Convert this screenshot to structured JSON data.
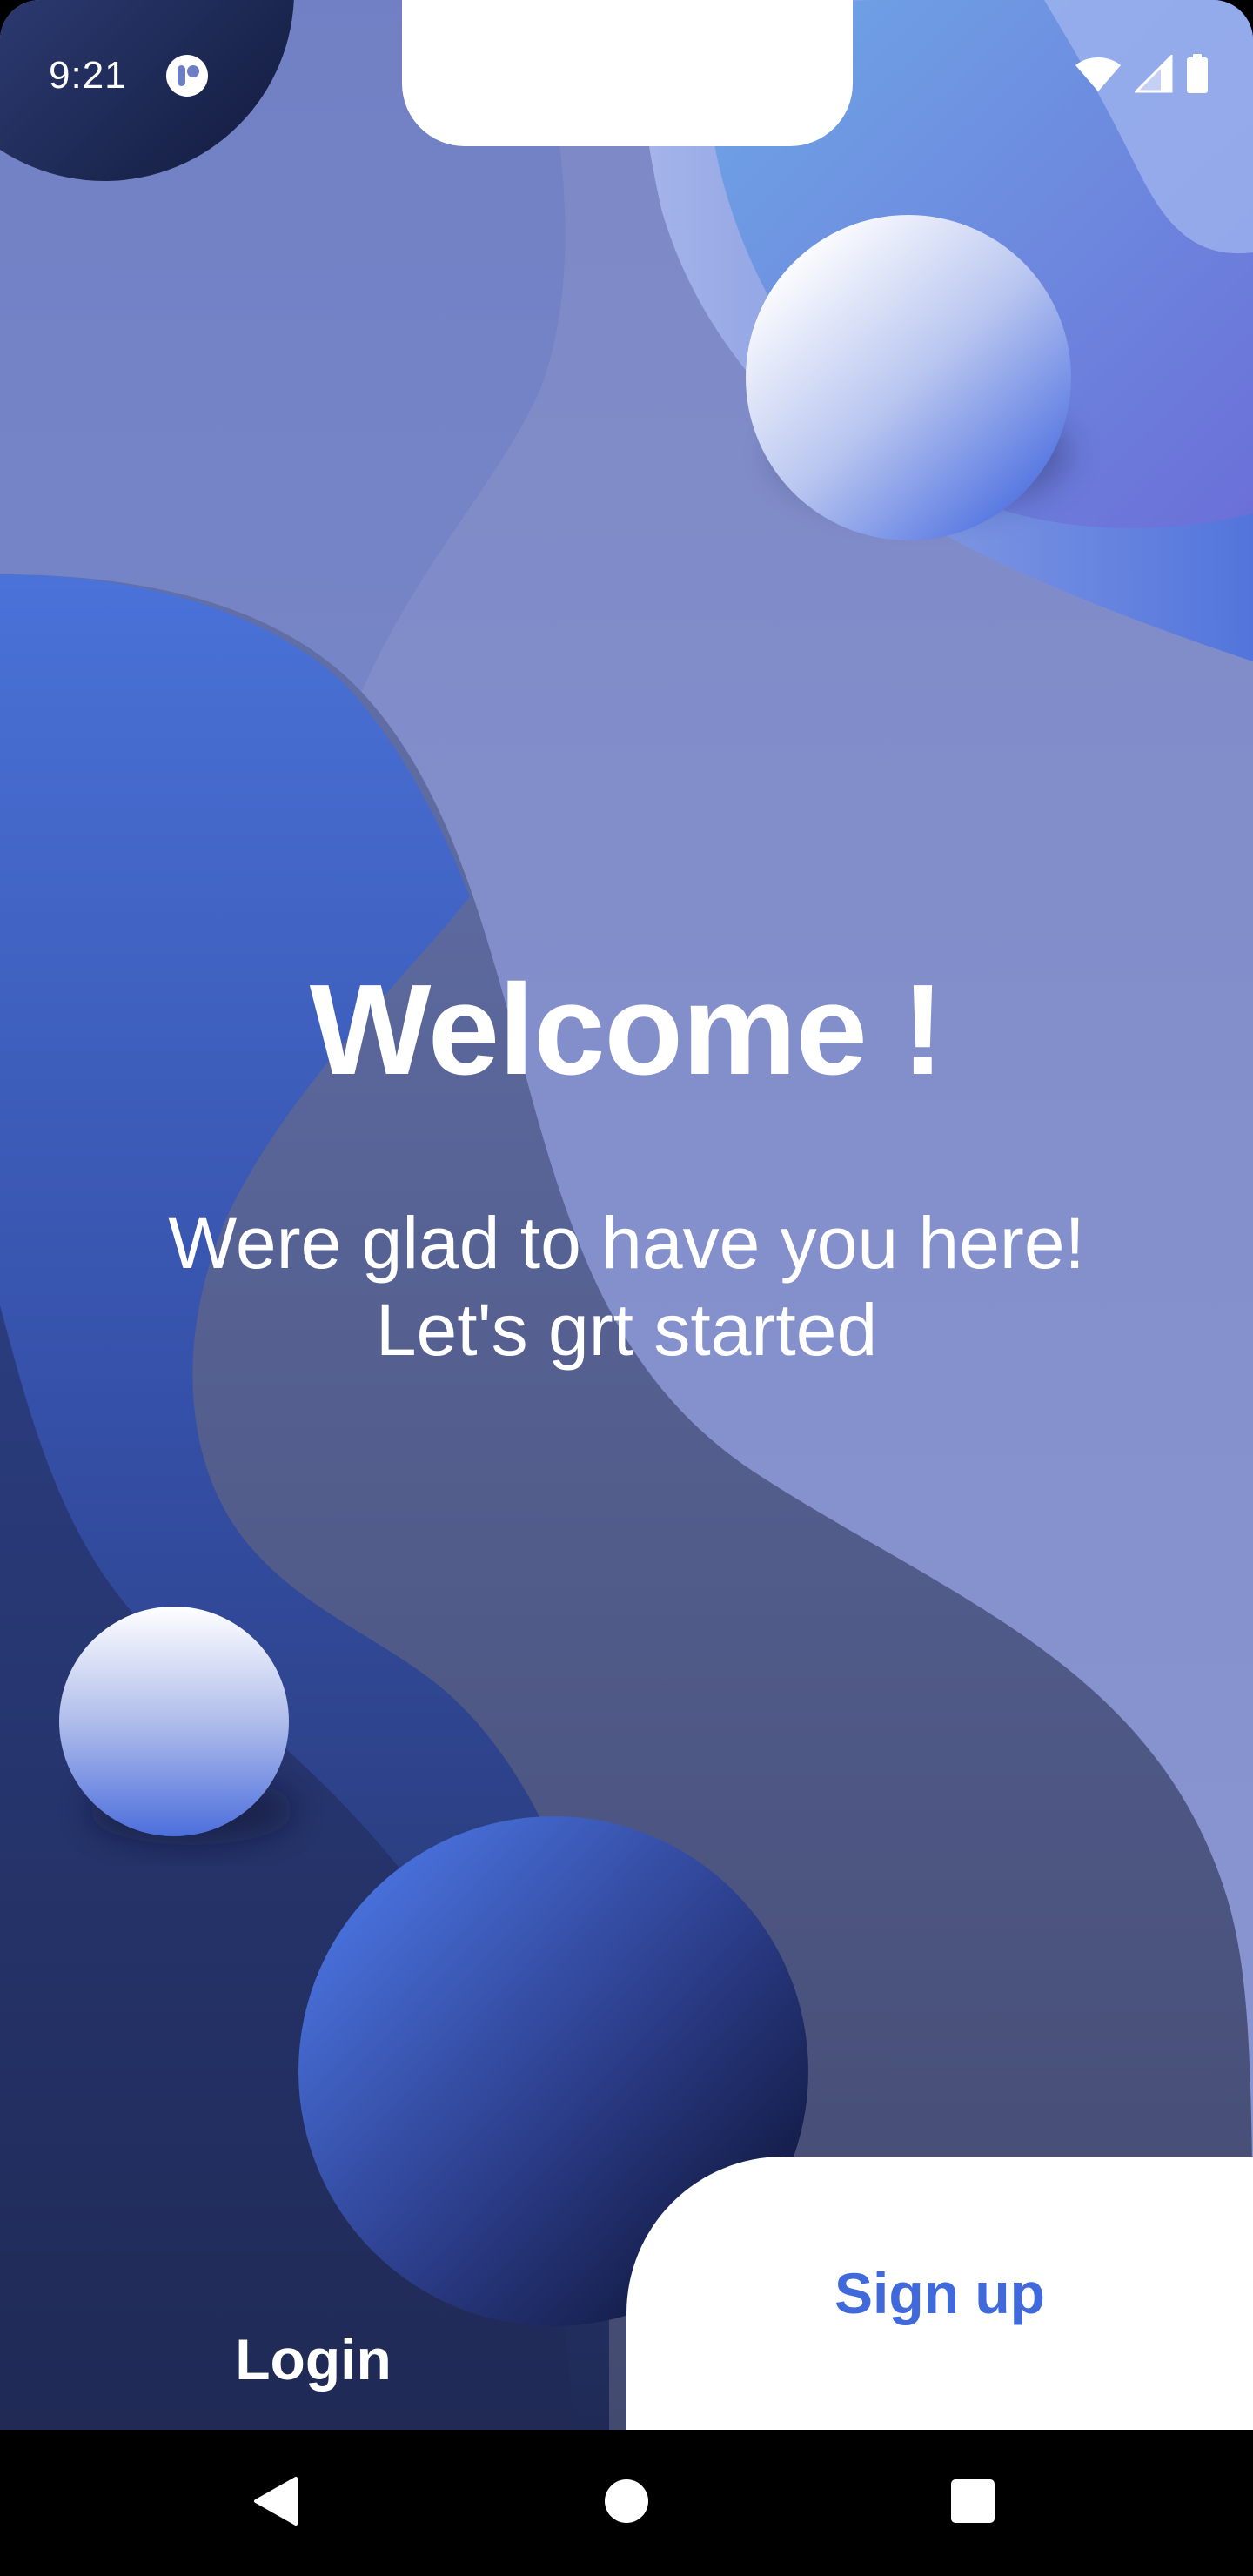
{
  "status_bar": {
    "time": "9:21",
    "app_icon": "notification-app-icon",
    "icons": [
      "wifi-icon",
      "cellular-signal-icon",
      "battery-icon"
    ]
  },
  "welcome": {
    "title": "Welcome !",
    "subtitle_line1": "Were glad to have you here!",
    "subtitle_line2": "Let's grt started"
  },
  "actions": {
    "login_label": "Login",
    "signup_label": "Sign up"
  },
  "nav_bar": {
    "icons": [
      "back-triangle-icon",
      "home-circle-icon",
      "recents-square-icon"
    ]
  },
  "colors": {
    "accent": "#4069dc",
    "background_light": "#8090cc",
    "background_dark": "#222d56",
    "text_on_dark": "#ffffff"
  }
}
